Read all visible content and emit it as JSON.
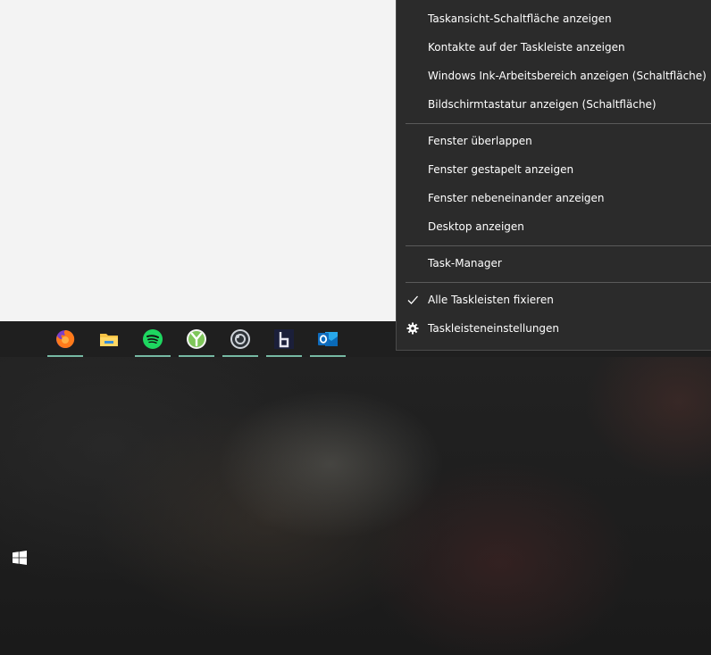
{
  "context_menu": {
    "items": [
      {
        "label": "Taskansicht-Schaltfläche anzeigen"
      },
      {
        "label": "Kontakte auf der Taskleiste anzeigen"
      },
      {
        "label": "Windows Ink-Arbeitsbereich anzeigen (Schaltfläche)"
      },
      {
        "label": "Bildschirmtastatur anzeigen (Schaltfläche)"
      },
      {
        "label": "Fenster überlappen"
      },
      {
        "label": "Fenster gestapelt anzeigen"
      },
      {
        "label": "Fenster nebeneinander anzeigen"
      },
      {
        "label": "Desktop anzeigen"
      },
      {
        "label": "Task-Manager"
      },
      {
        "label": "Alle Taskleisten fixieren",
        "checked": true,
        "icon": "checkmark-icon"
      },
      {
        "label": "Taskleisteneinstellungen",
        "icon": "gear-icon"
      }
    ]
  },
  "taskbar": {
    "apps": [
      {
        "name": "firefox",
        "icon": "firefox-icon"
      },
      {
        "name": "file-explorer",
        "icon": "folder-icon"
      },
      {
        "name": "spotify",
        "icon": "spotify-icon"
      },
      {
        "name": "y-app",
        "icon": "y-app-icon"
      },
      {
        "name": "obs",
        "icon": "obs-icon"
      },
      {
        "name": "rainbow-six",
        "icon": "rainbow-six-icon"
      },
      {
        "name": "outlook",
        "icon": "outlook-icon"
      }
    ],
    "active_underline_color": "#76b9a3",
    "start_icon": "windows-logo-icon"
  },
  "colors": {
    "menu_bg": "#2b2b2b",
    "menu_text": "#ffffff",
    "separator": "#5a5a5a",
    "window_bg": "#f3f3f3",
    "taskbar_bg": "#1f1f1f"
  }
}
